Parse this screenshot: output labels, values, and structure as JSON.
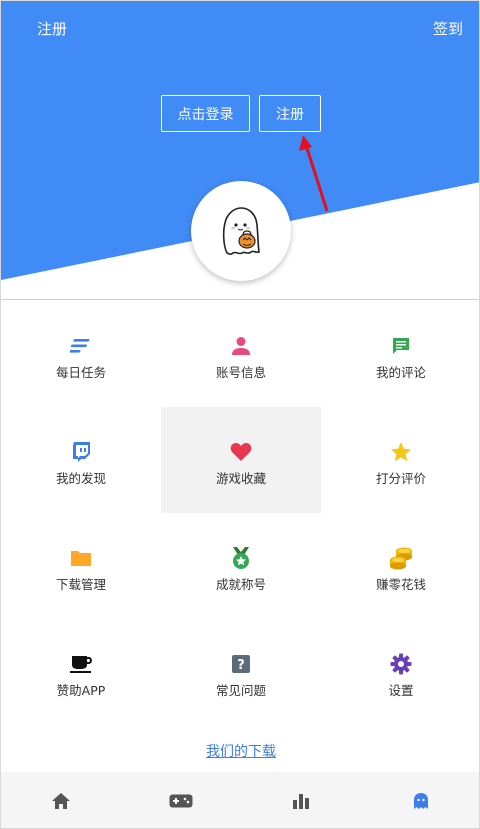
{
  "header": {
    "register_link": "注册",
    "checkin_link": "签到",
    "login_button": "点击登录",
    "register_button": "注册"
  },
  "colors": {
    "header_blue": "#418bf6",
    "link_blue": "#3d7eea",
    "arrow_red": "#e3101e",
    "nav_active": "#3d7eea",
    "nav_inactive": "#555555"
  },
  "menu": [
    {
      "label": "每日任务",
      "icon": "list-lines-icon",
      "color": "#3d7eea"
    },
    {
      "label": "账号信息",
      "icon": "person-icon",
      "color": "#e84a7f"
    },
    {
      "label": "我的评论",
      "icon": "comment-icon",
      "color": "#34a853"
    },
    {
      "label": "我的发现",
      "icon": "twitch-icon",
      "color": "#3d7eea"
    },
    {
      "label": "游戏收藏",
      "icon": "heart-icon",
      "color": "#e53950"
    },
    {
      "label": "打分评价",
      "icon": "star-icon",
      "color": "#f5c518"
    },
    {
      "label": "下载管理",
      "icon": "folder-icon",
      "color": "#ffa726"
    },
    {
      "label": "成就称号",
      "icon": "medal-icon",
      "color": "#34a853"
    },
    {
      "label": "赚零花钱",
      "icon": "coins-icon",
      "color": "#f2b800"
    },
    {
      "label": "赞助APP",
      "icon": "coffee-cup-icon",
      "color": "#111111"
    },
    {
      "label": "常见问题",
      "icon": "question-icon",
      "color": "#5b6b7a"
    },
    {
      "label": "设置",
      "icon": "gear-icon",
      "color": "#6a3fb6"
    }
  ],
  "download_link": "我们的下载",
  "bottom_nav": [
    {
      "name": "home",
      "icon": "home-icon",
      "active": false
    },
    {
      "name": "games",
      "icon": "gamepad-icon",
      "active": false
    },
    {
      "name": "stats",
      "icon": "bar-chart-icon",
      "active": false
    },
    {
      "name": "profile",
      "icon": "ghost-icon",
      "active": true
    }
  ]
}
